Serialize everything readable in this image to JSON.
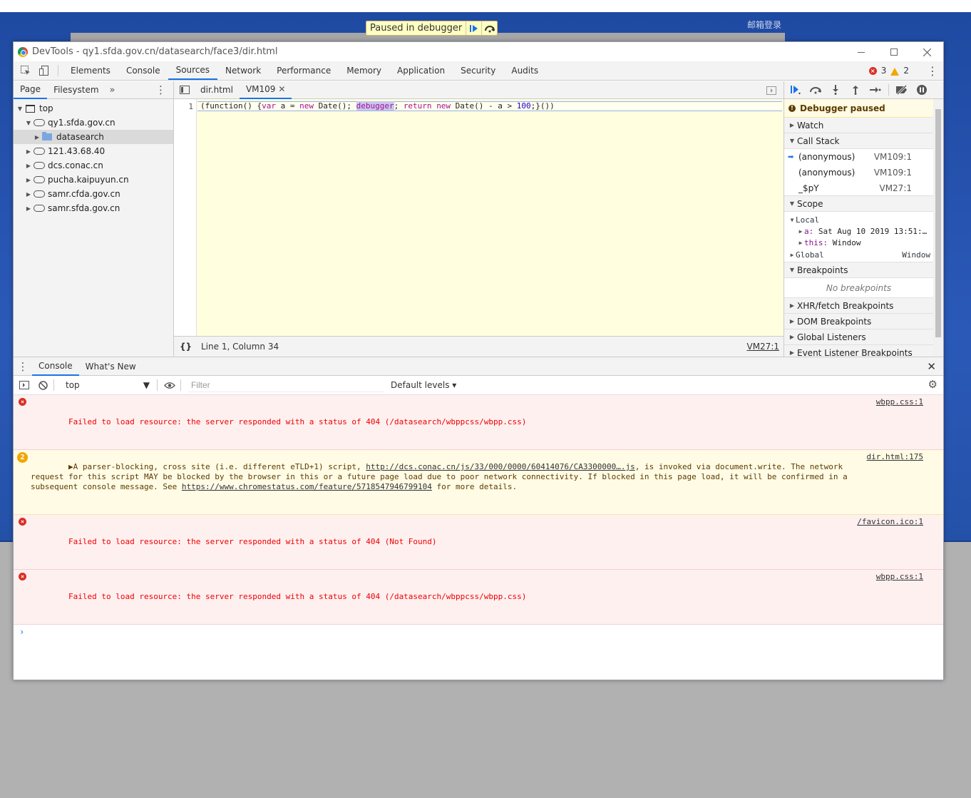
{
  "background": {
    "email_login": "邮箱登录"
  },
  "paused_overlay": {
    "text": "Paused in debugger"
  },
  "window": {
    "title": "DevTools - qy1.sfda.gov.cn/datasearch/face3/dir.html"
  },
  "main_tabs": [
    "Elements",
    "Console",
    "Sources",
    "Network",
    "Performance",
    "Memory",
    "Application",
    "Security",
    "Audits"
  ],
  "active_main_tab": "Sources",
  "issues": {
    "errors": "3",
    "warnings": "2"
  },
  "navigator": {
    "tabs": [
      "Page",
      "Filesystem"
    ],
    "more": "»",
    "tree": {
      "top": "top",
      "origin_main": "qy1.sfda.gov.cn",
      "folder": "datasearch",
      "others": [
        "121.43.68.40",
        "dcs.conac.cn",
        "pucha.kaipuyun.cn",
        "samr.cfda.gov.cn",
        "samr.sfda.gov.cn"
      ]
    }
  },
  "editor": {
    "tabs": [
      "dir.html",
      "VM109"
    ],
    "line_number": "1",
    "code": {
      "t1": "(function() {",
      "t2": "var",
      "t3": " a = ",
      "t4": "new",
      "t5": " Date(); ",
      "t6": "debugger",
      "t7": "; ",
      "t8": "return",
      "t9": " ",
      "t10": "new",
      "t11": " Date() - a > ",
      "t12": "100",
      "t13": ";}())"
    },
    "pretty_print": "{}",
    "cursor_position": "Line 1, Column 34",
    "status_source": "VM27:1"
  },
  "debugger": {
    "paused_banner": "Debugger paused",
    "watch": "Watch",
    "call_stack": "Call Stack",
    "frames": [
      {
        "name": "(anonymous)",
        "location": "VM109:1"
      },
      {
        "name": "(anonymous)",
        "location": "VM109:1"
      },
      {
        "name": "_$pY",
        "location": "VM27:1"
      }
    ],
    "scope": "Scope",
    "local": "Local",
    "local_a_key": "a:",
    "local_a_val": "Sat Aug 10 2019 13:51:…",
    "local_this_key": "this:",
    "local_this_val": "Window",
    "global": "Global",
    "global_val": "Window",
    "breakpoints": "Breakpoints",
    "no_breakpoints": "No breakpoints",
    "xhr_breakpoints": "XHR/fetch Breakpoints",
    "dom_breakpoints": "DOM Breakpoints",
    "global_listeners": "Global Listeners",
    "event_listener_breakpoints": "Event Listener Breakpoints"
  },
  "drawer": {
    "tabs": [
      "Console",
      "What's New"
    ],
    "context": "top",
    "filter_placeholder": "Filter",
    "levels": "Default levels ▾",
    "messages": [
      {
        "type": "error",
        "text": "Failed to load resource: the server responded with a status of 404 (/datasearch/wbppcss/wbpp.css)",
        "source": "wbpp.css:1"
      },
      {
        "type": "warn",
        "count": "2",
        "prefix": "▶A parser-blocking, cross site (i.e. different eTLD+1) script, ",
        "link1": "http://dcs.conac.cn/js/33/000/0000/60414076/CA3300000….js",
        "middle": ", is invoked via document.write. The network request for this script MAY be blocked by the browser in this or a future page load due to poor network connectivity. If blocked in this page load, it will be confirmed in a subsequent console message. See ",
        "link2": "https://www.chromestatus.com/feature/5718547946799104",
        "suffix": " for more details.",
        "source": "dir.html:175"
      },
      {
        "type": "error",
        "text": "Failed to load resource: the server responded with a status of 404 (Not Found)",
        "source": "/favicon.ico:1"
      },
      {
        "type": "error",
        "text": "Failed to load resource: the server responded with a status of 404 (/datasearch/wbppcss/wbpp.css)",
        "source": "wbpp.css:1"
      }
    ],
    "prompt": "›"
  },
  "colors": {
    "accent": "#1a73e8",
    "error": "#d93025",
    "warning": "#f2a600",
    "paused_bg": "#ffffe0"
  }
}
